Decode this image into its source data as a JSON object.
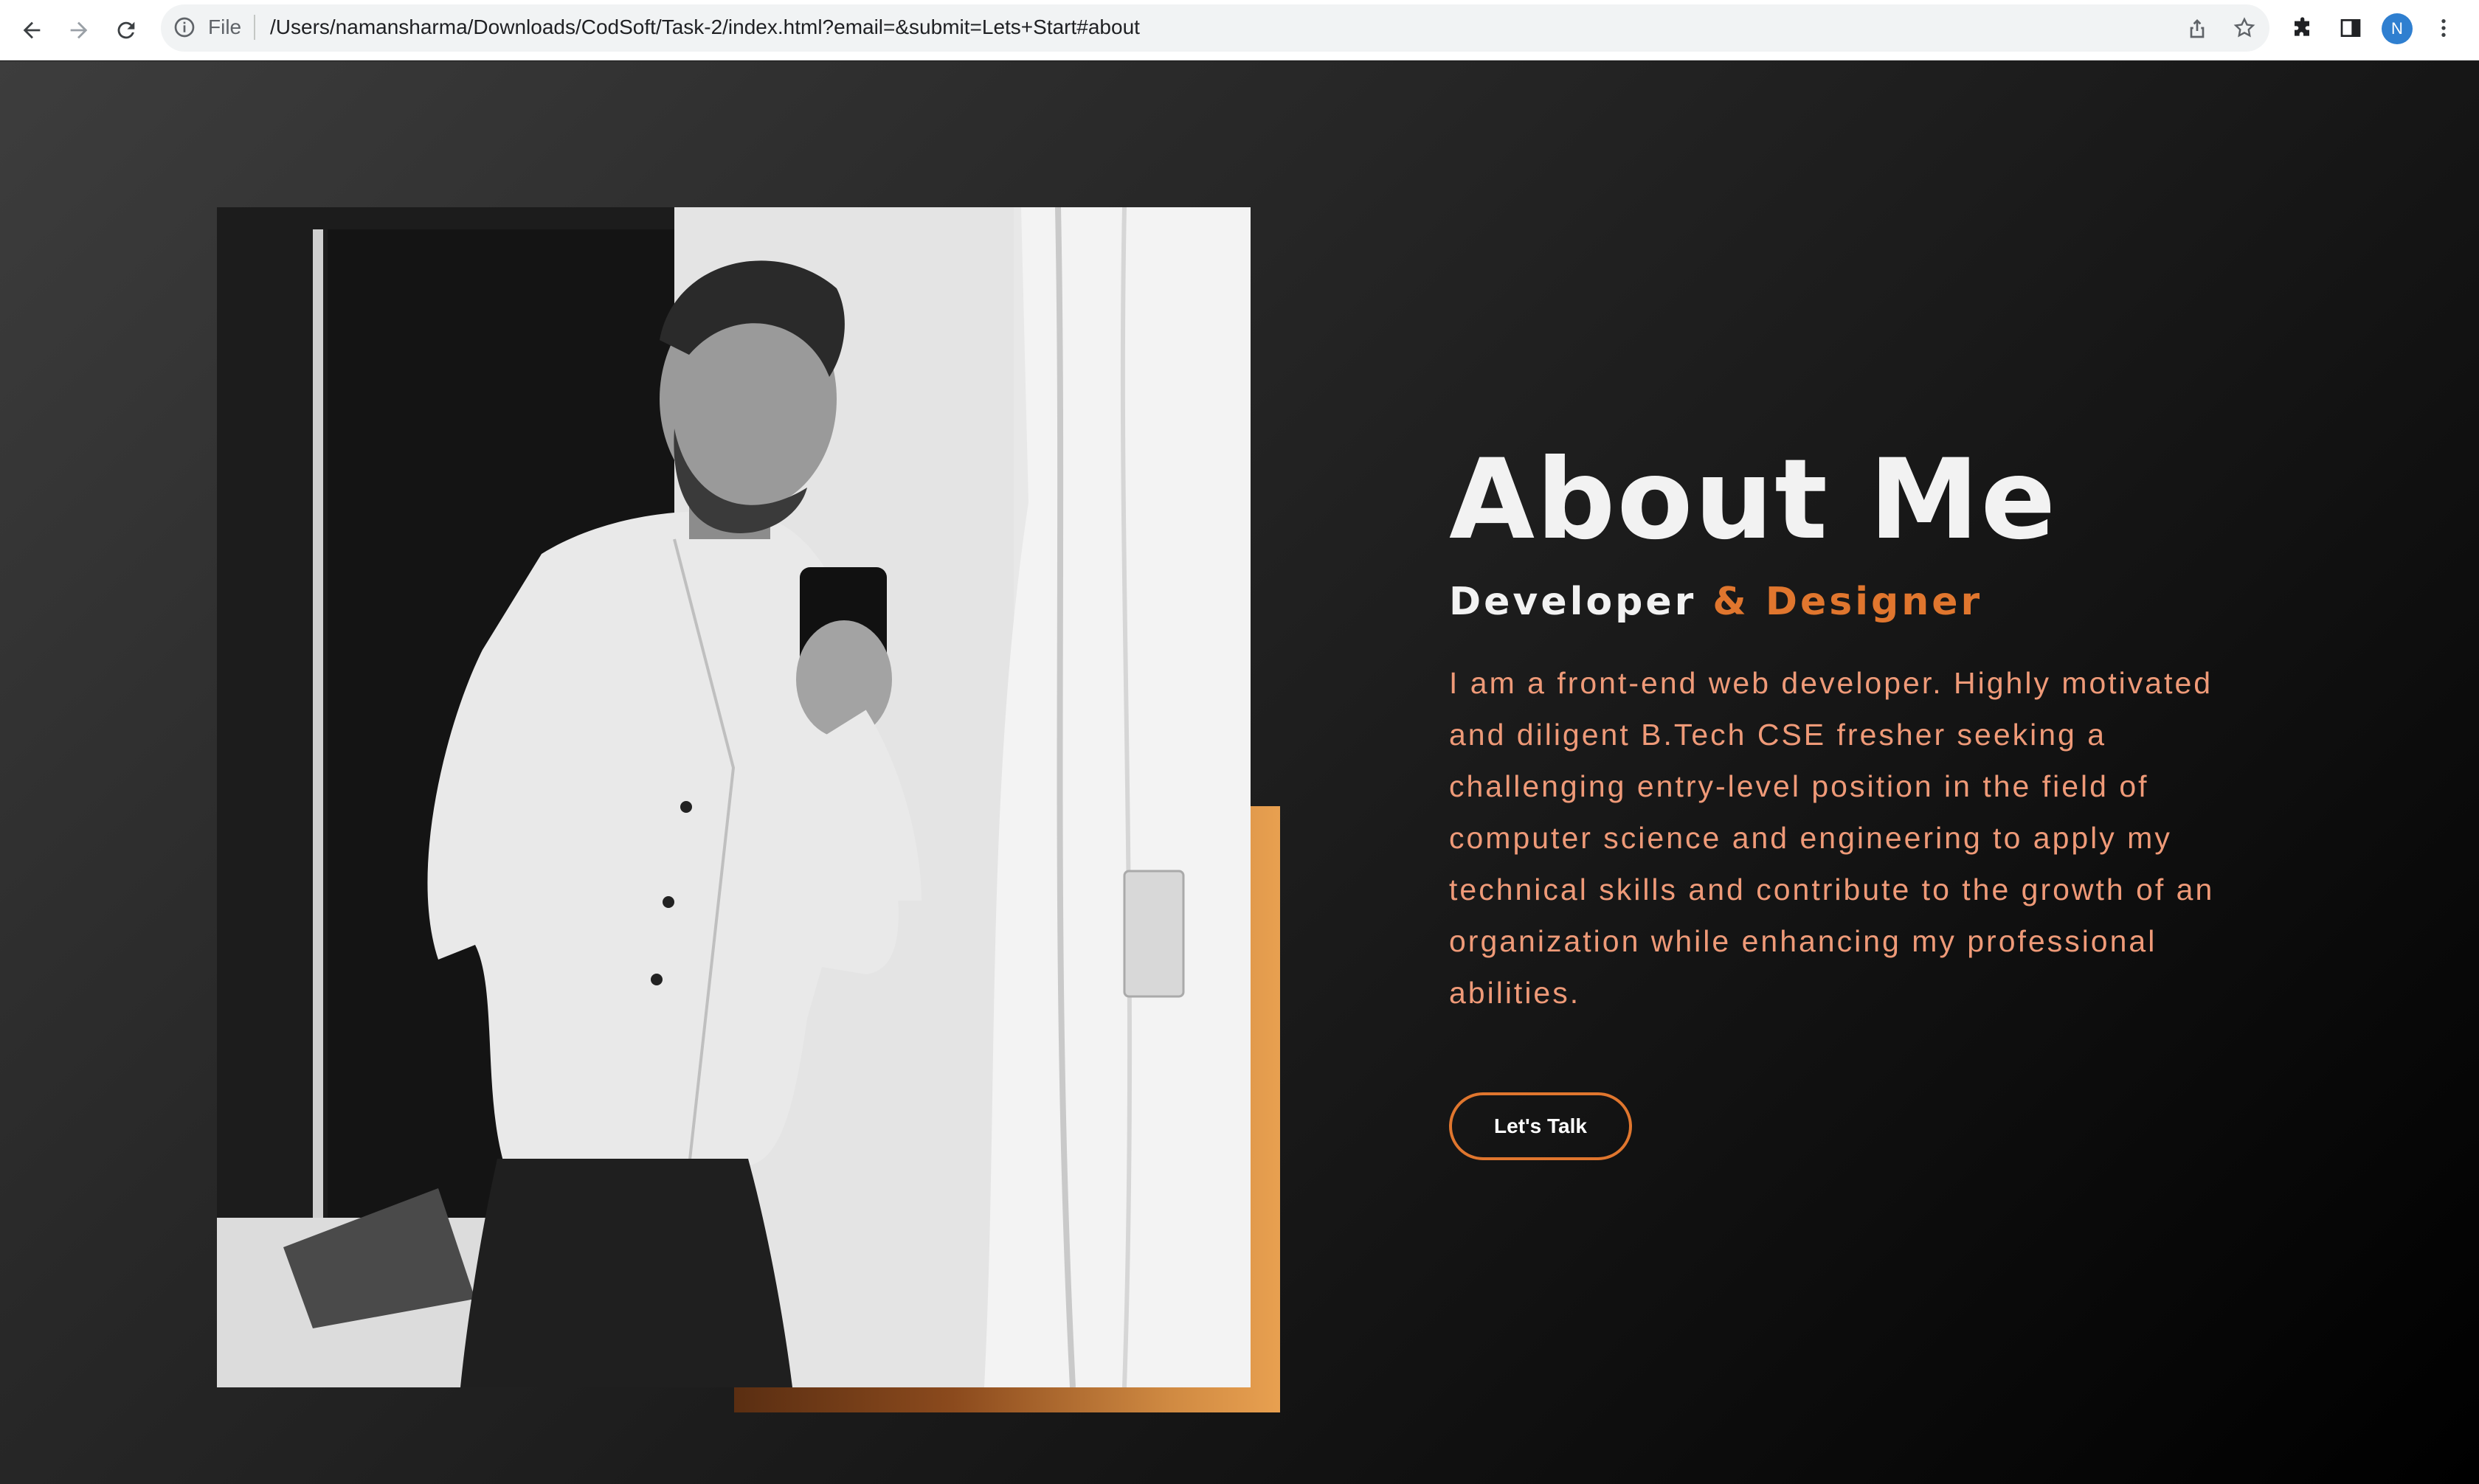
{
  "browser": {
    "scheme_label": "File",
    "url": "/Users/namansharma/Downloads/CodSoft/Task-2/index.html?email=&submit=Lets+Start#about",
    "profile_initial": "N"
  },
  "about": {
    "title": "About Me",
    "subtitle_part1": "Developer",
    "subtitle_part2": " & Designer",
    "description": "I am a front-end web developer. Highly motivated and diligent B.Tech CSE fresher seeking a challenging entry-level position in the field of computer science and engineering to apply my technical skills and contribute to the growth of an organization while enhancing my professional abilities.",
    "cta_label": "Let's Talk"
  },
  "colors": {
    "accent": "#e0762e",
    "body_text": "#ef9a78",
    "heading": "#f2f2f2"
  }
}
